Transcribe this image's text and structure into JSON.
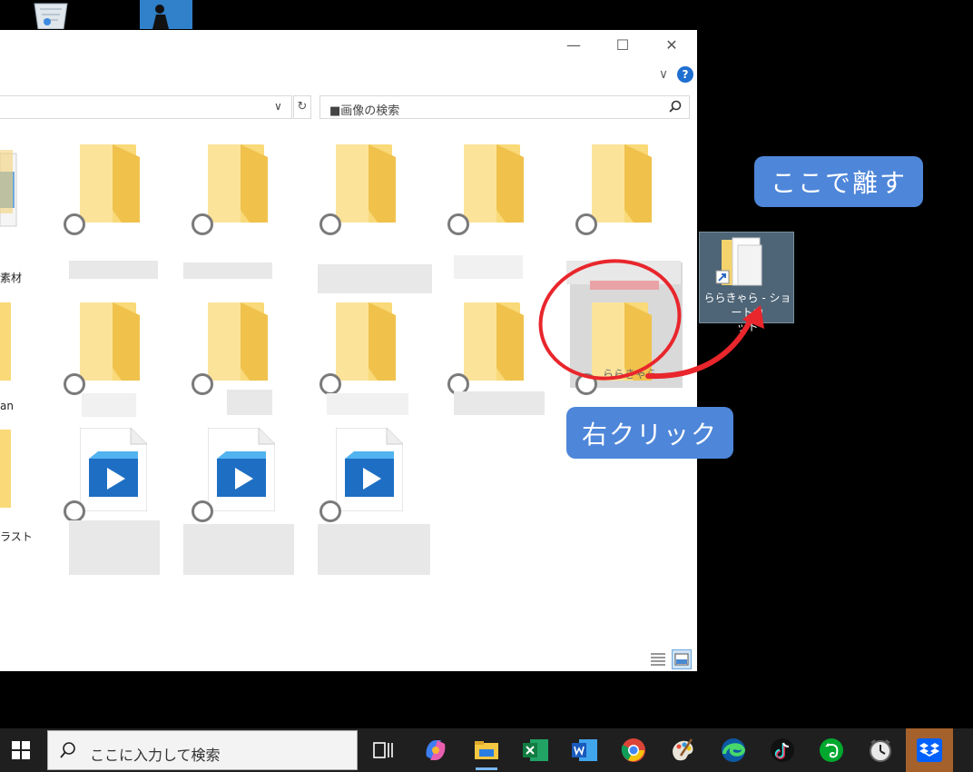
{
  "search": {
    "placeholder": "■画像の検索"
  },
  "window": {
    "min_glyph": "—",
    "max_glyph": "☐",
    "close_glyph": "✕"
  },
  "ribbon": {
    "expand_glyph": "∨",
    "help_glyph": "?"
  },
  "address": {
    "dropdown_glyph": "∨",
    "refresh_glyph": "↻"
  },
  "items_partial_labels": [
    "素材",
    "an",
    "ラスト"
  ],
  "selected_folder": {
    "label": "ららきゃら"
  },
  "shortcut": {
    "label_line1": "ららきゃら - ショートカ",
    "label_line2": "ット"
  },
  "callouts": {
    "release": "ここで離す",
    "right_click": "右クリック"
  },
  "taskbar": {
    "search_text": "ここに入力して検索"
  },
  "colors": {
    "callout": "#4e86d9",
    "annotation": "#e8262c",
    "taskbar": "#1f1f1f"
  }
}
